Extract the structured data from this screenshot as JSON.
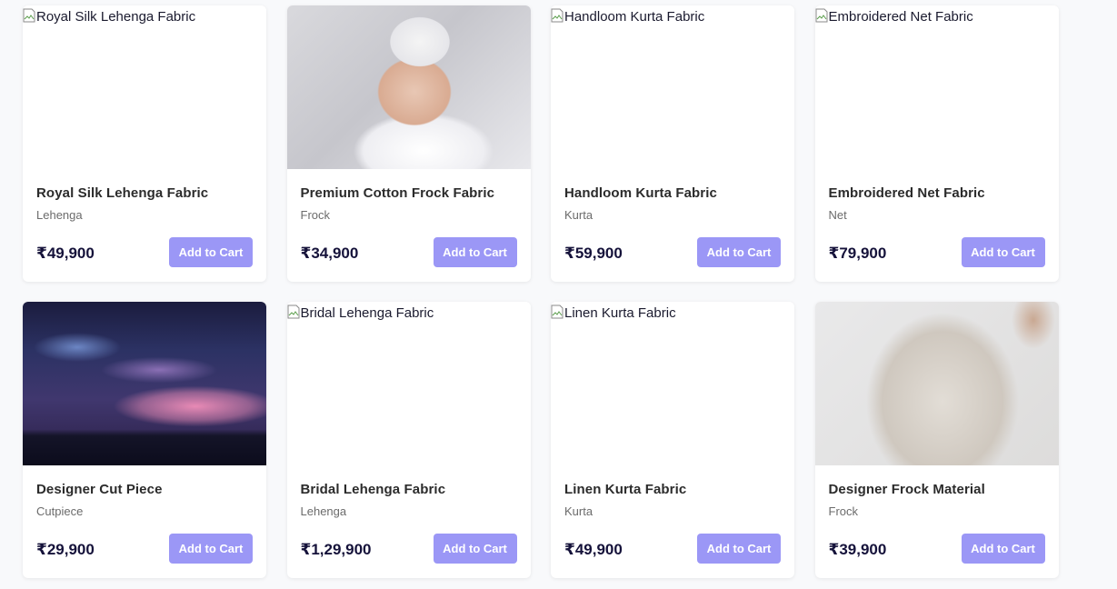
{
  "products": [
    {
      "title": "Royal Silk Lehenga Fabric",
      "category": "Lehenga",
      "price": "₹49,900",
      "image_alt": "Royal Silk Lehenga Fabric",
      "image_state": "broken",
      "cart_label": "Add to Cart"
    },
    {
      "title": "Premium Cotton Frock Fabric",
      "category": "Frock",
      "price": "₹34,900",
      "image_alt": "",
      "image_state": "photo-baby",
      "cart_label": "Add to Cart"
    },
    {
      "title": "Handloom Kurta Fabric",
      "category": "Kurta",
      "price": "₹59,900",
      "image_alt": "Handloom Kurta Fabric",
      "image_state": "broken",
      "cart_label": "Add to Cart"
    },
    {
      "title": "Embroidered Net Fabric",
      "category": "Net",
      "price": "₹79,900",
      "image_alt": "Embroidered Net Fabric",
      "image_state": "broken",
      "cart_label": "Add to Cart"
    },
    {
      "title": "Designer Cut Piece",
      "category": "Cutpiece",
      "price": "₹29,900",
      "image_alt": "",
      "image_state": "photo-sky",
      "cart_label": "Add to Cart"
    },
    {
      "title": "Bridal Lehenga Fabric",
      "category": "Lehenga",
      "price": "₹1,29,900",
      "image_alt": "Bridal Lehenga Fabric",
      "image_state": "broken",
      "cart_label": "Add to Cart"
    },
    {
      "title": "Linen Kurta Fabric",
      "category": "Kurta",
      "price": "₹49,900",
      "image_alt": "Linen Kurta Fabric",
      "image_state": "broken",
      "cart_label": "Add to Cart"
    },
    {
      "title": "Designer Frock Material",
      "category": "Frock",
      "price": "₹39,900",
      "image_alt": "",
      "image_state": "photo-sweater",
      "cart_label": "Add to Cart"
    }
  ],
  "colors": {
    "button_bg": "#9b97f6",
    "price_text": "#15123a",
    "page_bg": "#f8f9fb"
  }
}
